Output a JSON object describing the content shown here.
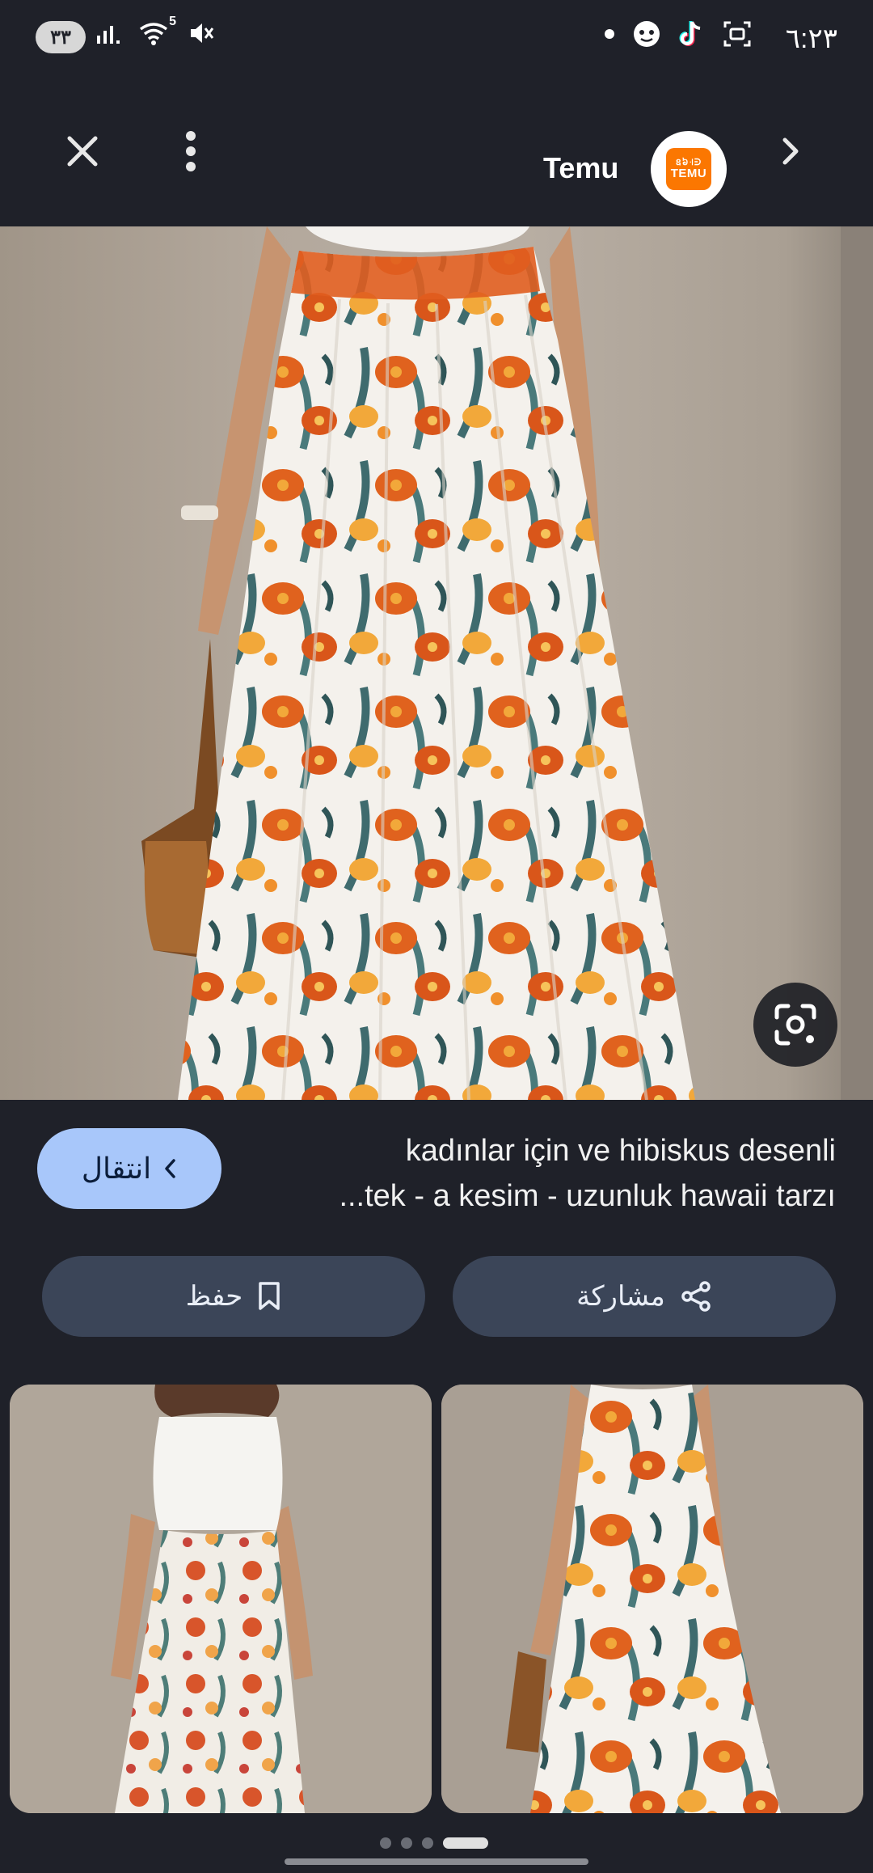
{
  "status_bar": {
    "badge": "٣٣",
    "time": "٦:٢٣",
    "network_label": "5"
  },
  "header": {
    "source_name": "Temu",
    "logo_text_top": "ឧ៦꜊ᕭ",
    "logo_text_bottom": "TEMU",
    "icons": [
      "close-icon",
      "more-vert-icon",
      "chevron-right-icon"
    ]
  },
  "result": {
    "title_line1": "kadınlar için ve hibiskus desenli",
    "title_line2": "...tek - a kesim - uzunluk hawaii tarzı",
    "visit_label": "انتقال"
  },
  "actions": {
    "share_label": "مشاركة",
    "save_label": "حفظ"
  },
  "colors": {
    "background": "#1f2129",
    "visit_button": "#a8c7fa",
    "action_button": "#3b4558",
    "brand": "#fb7701"
  },
  "pager": {
    "active_index": 3,
    "count": 4
  }
}
